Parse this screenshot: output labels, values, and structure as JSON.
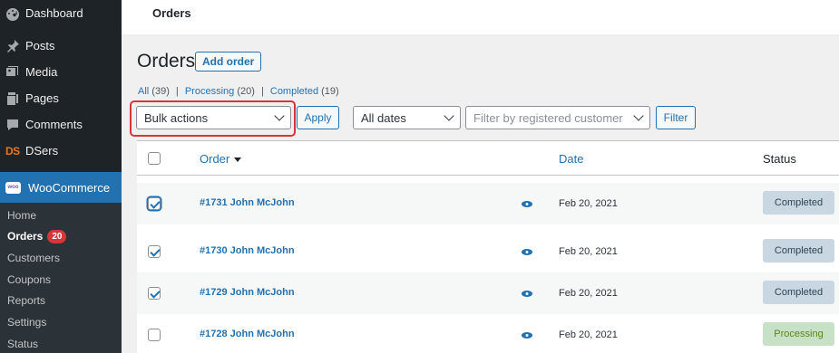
{
  "sidebar": {
    "items": [
      {
        "label": "Dashboard",
        "icon": "dashboard-icon"
      },
      {
        "label": "Posts",
        "icon": "pin-icon"
      },
      {
        "label": "Media",
        "icon": "media-icon"
      },
      {
        "label": "Pages",
        "icon": "pages-icon"
      },
      {
        "label": "Comments",
        "icon": "comment-icon"
      },
      {
        "label": "DSers",
        "icon": "dsers-logo",
        "logo_text": "DS"
      },
      {
        "label": "WooCommerce",
        "icon": "woocommerce-icon",
        "logo_text": "woo"
      }
    ],
    "submenu": [
      {
        "label": "Home"
      },
      {
        "label": "Orders",
        "badge": "20"
      },
      {
        "label": "Customers"
      },
      {
        "label": "Coupons"
      },
      {
        "label": "Reports"
      },
      {
        "label": "Settings"
      },
      {
        "label": "Status"
      }
    ]
  },
  "header": {
    "title": "Orders"
  },
  "page": {
    "title": "Orders",
    "add_button": "Add order"
  },
  "filters": {
    "all": {
      "label": "All",
      "count": "(39)"
    },
    "processing": {
      "label": "Processing",
      "count": "(20)"
    },
    "completed": {
      "label": "Completed",
      "count": "(19)"
    },
    "separator": "|"
  },
  "toolbar": {
    "bulk_actions": "Bulk actions",
    "apply": "Apply",
    "dates": "All dates",
    "customer_placeholder": "Filter by registered customer",
    "filter": "Filter"
  },
  "table": {
    "columns": {
      "order": "Order",
      "date": "Date",
      "status": "Status"
    },
    "rows": [
      {
        "order": "#1731 John McJohn",
        "date": "Feb 20, 2021",
        "status": "Completed",
        "checked": true
      },
      {
        "order": "#1730 John McJohn",
        "date": "Feb 20, 2021",
        "status": "Completed",
        "checked": true
      },
      {
        "order": "#1729 John McJohn",
        "date": "Feb 20, 2021",
        "status": "Completed",
        "checked": true
      },
      {
        "order": "#1728 John McJohn",
        "date": "Feb 20, 2021",
        "status": "Processing",
        "checked": false
      }
    ]
  },
  "colors": {
    "accent": "#2271b1",
    "sidebar": "#1d2327",
    "highlight": "#d63638"
  }
}
